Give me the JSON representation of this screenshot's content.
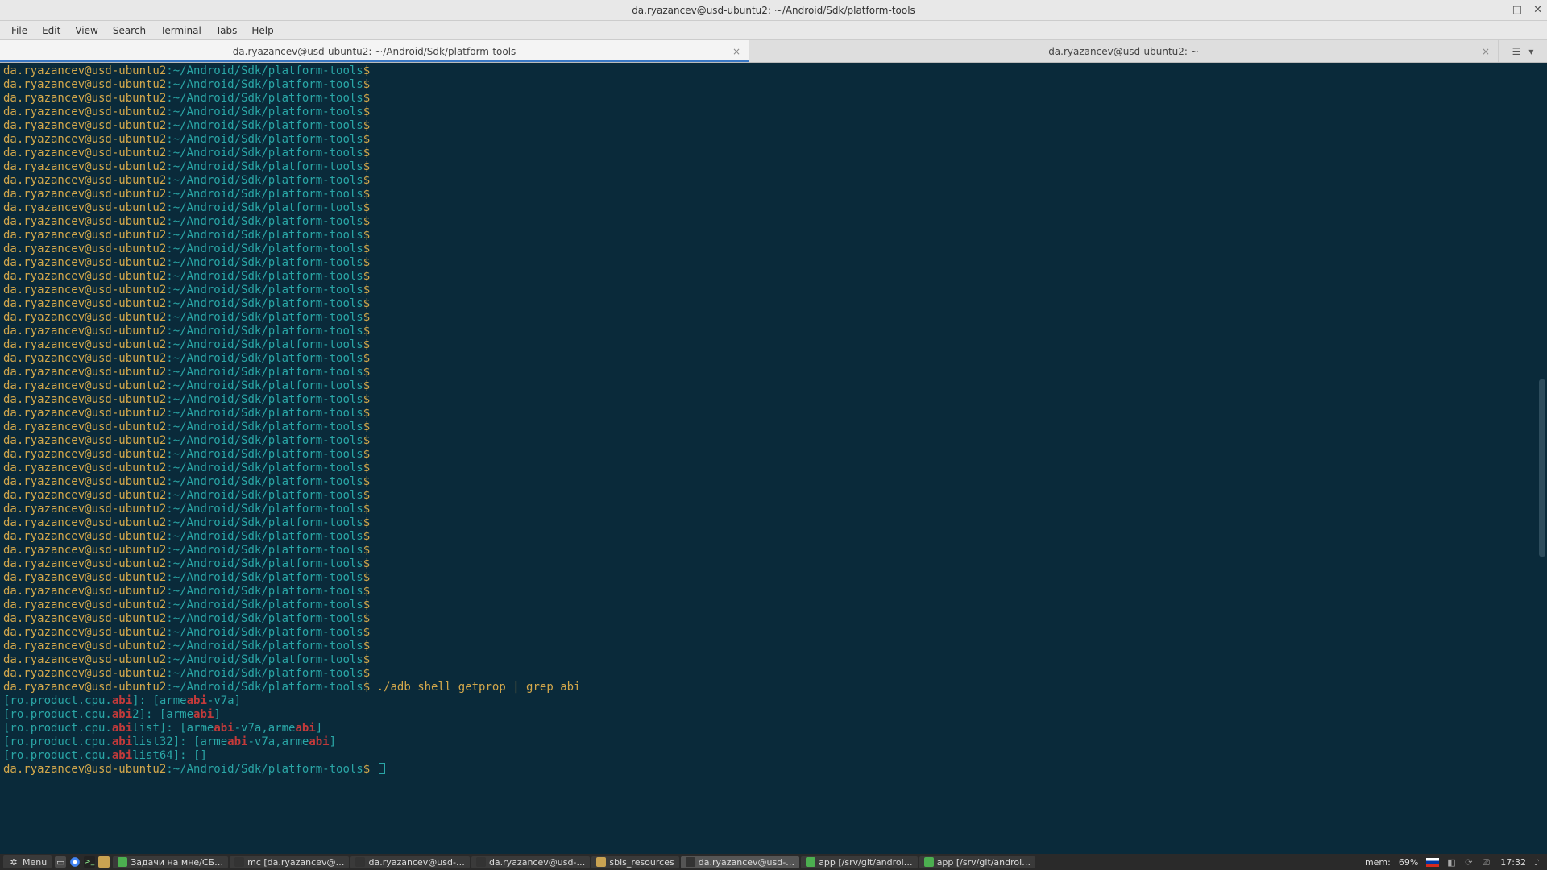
{
  "window": {
    "title": "da.ryazancev@usd-ubuntu2: ~/Android/Sdk/platform-tools"
  },
  "menu": [
    "File",
    "Edit",
    "View",
    "Search",
    "Terminal",
    "Tabs",
    "Help"
  ],
  "tabs": [
    {
      "label": "da.ryazancev@usd-ubuntu2: ~/Android/Sdk/platform-tools",
      "active": true
    },
    {
      "label": "da.ryazancev@usd-ubuntu2: ~",
      "active": false
    }
  ],
  "prompt": {
    "userhost": "da.ryazancev@usd-ubuntu2",
    "path": "~/Android/Sdk/platform-tools",
    "sigil": "$",
    "empty_count": 45,
    "command": "./adb shell getprop | grep abi"
  },
  "output": [
    {
      "key": "[ro.product.cpu.",
      "hi": "abi",
      "rest": "]: [arme",
      "hi2": "abi",
      "rest2": "-v7a]"
    },
    {
      "key": "[ro.product.cpu.",
      "hi": "abi",
      "rest": "2]: [arme",
      "hi2": "abi",
      "rest2": "]"
    },
    {
      "key": "[ro.product.cpu.",
      "hi": "abi",
      "rest": "list]: [arme",
      "hi2": "abi",
      "rest2": "-v7a,arme",
      "hi3": "abi",
      "rest3": "]"
    },
    {
      "key": "[ro.product.cpu.",
      "hi": "abi",
      "rest": "list32]: [arme",
      "hi2": "abi",
      "rest2": "-v7a,arme",
      "hi3": "abi",
      "rest3": "]"
    },
    {
      "key": "[ro.product.cpu.",
      "hi": "abi",
      "rest": "list64]: []"
    }
  ],
  "taskbar": {
    "menu_label": "Menu",
    "apps": [
      {
        "label": "Задачи на мне/СБ…",
        "color": "#4caf50",
        "type": "chrome"
      },
      {
        "label": "mc [da.ryazancev@…",
        "color": "#333",
        "type": "term"
      },
      {
        "label": "da.ryazancev@usd-…",
        "color": "#333",
        "type": "term"
      },
      {
        "label": "da.ryazancev@usd-…",
        "color": "#333",
        "type": "term"
      },
      {
        "label": "sbis_resources",
        "color": "#caa352",
        "type": "folder"
      },
      {
        "label": "da.ryazancev@usd-…",
        "color": "#333",
        "type": "term",
        "active": true
      },
      {
        "label": "app [/srv/git/androi…",
        "color": "#4caf50",
        "type": "android"
      },
      {
        "label": "app [/srv/git/androi…",
        "color": "#4caf50",
        "type": "android"
      }
    ],
    "mem_label": "mem:",
    "mem_value": "69%",
    "time": "17:32"
  }
}
